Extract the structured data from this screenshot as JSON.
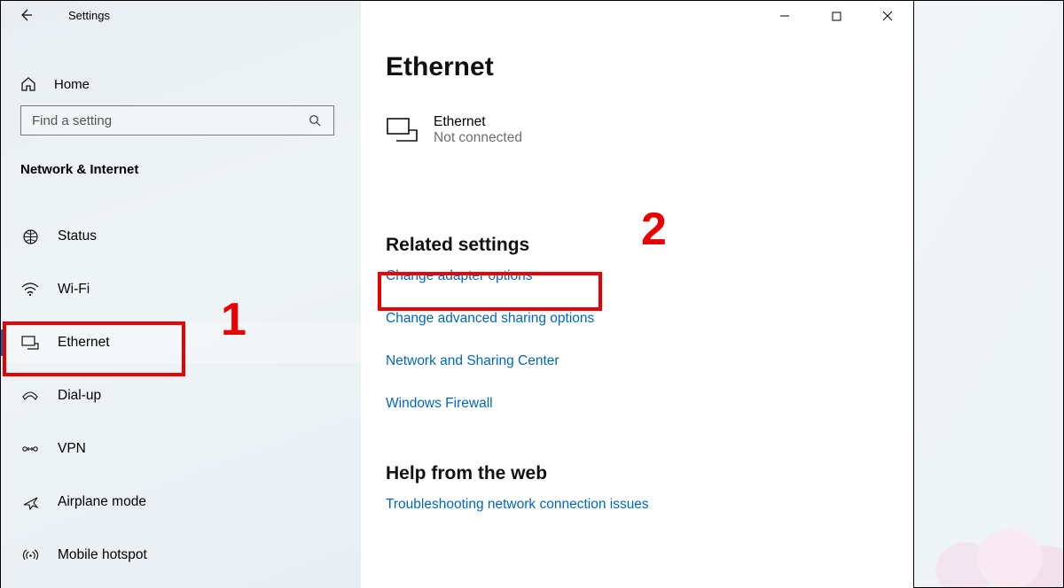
{
  "window": {
    "title": "Settings"
  },
  "sidebar": {
    "home_label": "Home",
    "search_placeholder": "Find a setting",
    "category": "Network & Internet",
    "items": [
      {
        "label": "Status"
      },
      {
        "label": "Wi-Fi"
      },
      {
        "label": "Ethernet"
      },
      {
        "label": "Dial-up"
      },
      {
        "label": "VPN"
      },
      {
        "label": "Airplane mode"
      },
      {
        "label": "Mobile hotspot"
      }
    ]
  },
  "main": {
    "heading": "Ethernet",
    "status_name": "Ethernet",
    "status_sub": "Not connected",
    "related_heading": "Related settings",
    "related_links": [
      "Change adapter options",
      "Change advanced sharing options",
      "Network and Sharing Center",
      "Windows Firewall"
    ],
    "help_heading": "Help from the web",
    "help_links": [
      "Troubleshooting network connection issues"
    ]
  },
  "annotations": {
    "marker1": "1",
    "marker2": "2"
  }
}
